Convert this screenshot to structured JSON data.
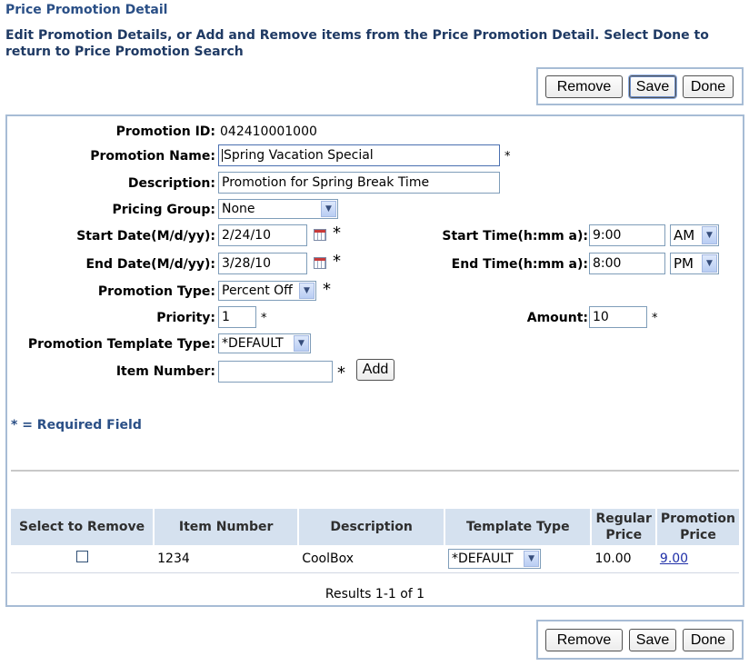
{
  "header": {
    "title": "Price Promotion Detail",
    "intro": "Edit Promotion Details, or Add and Remove items from the Price Promotion Detail. Select Done to return to Price Promotion Search"
  },
  "toolbar": {
    "remove_label": "Remove",
    "save_label": "Save",
    "done_label": "Done"
  },
  "form": {
    "promotion_id": {
      "label": "Promotion ID:",
      "value": "042410001000"
    },
    "promotion_name": {
      "label": "Promotion Name:",
      "value": "Spring Vacation Special"
    },
    "description": {
      "label": "Description:",
      "value": "Promotion for Spring Break Time"
    },
    "pricing_group": {
      "label": "Pricing Group:",
      "value": "None"
    },
    "start_date": {
      "label": "Start Date(M/d/yy):",
      "value": "2/24/10"
    },
    "end_date": {
      "label": "End Date(M/d/yy):",
      "value": "3/28/10"
    },
    "start_time": {
      "label": "Start Time(h:mm a):",
      "value": "9:00",
      "ampm": "AM"
    },
    "end_time": {
      "label": "End Time(h:mm a):",
      "value": "8:00",
      "ampm": "PM"
    },
    "promotion_type": {
      "label": "Promotion Type:",
      "value": "Percent Off"
    },
    "priority": {
      "label": "Priority:",
      "value": "1"
    },
    "amount": {
      "label": "Amount:",
      "value": "10"
    },
    "template_type": {
      "label": "Promotion Template Type:",
      "value": "*DEFAULT"
    },
    "item_number": {
      "label": "Item Number:",
      "value": "",
      "add_label": "Add"
    },
    "required_marker": "*",
    "required_note": "* = Required Field"
  },
  "table": {
    "headers": {
      "select": "Select to Remove",
      "item_number": "Item Number",
      "description": "Description",
      "template_type": "Template Type",
      "regular_price_1": "Regular",
      "regular_price_2": "Price",
      "promotion_price_1": "Promotion",
      "promotion_price_2": "Price"
    },
    "rows": [
      {
        "checked": false,
        "item_number": "1234",
        "description": "CoolBox",
        "template_type": "*DEFAULT",
        "regular_price": "10.00",
        "promotion_price": "9.00"
      }
    ],
    "results": "Results 1-1 of 1"
  },
  "icons": {
    "dropdown": "chevron-down-icon",
    "calendar": "calendar-icon",
    "checkbox": "checkbox-icon"
  },
  "colors": {
    "title": "#2a4f86",
    "panel_border": "#a7bcd5",
    "table_header": "#d5e1ef",
    "link": "#1f2fa8"
  }
}
